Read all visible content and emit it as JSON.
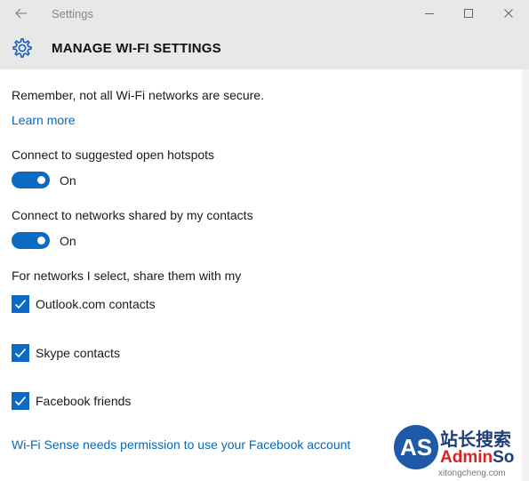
{
  "window": {
    "title": "Settings"
  },
  "header": {
    "title": "MANAGE WI-FI SETTINGS"
  },
  "main": {
    "intro": "Remember, not all Wi-Fi networks are secure.",
    "learn_more": "Learn more",
    "hotspots": {
      "label": "Connect to suggested open hotspots",
      "state": "On"
    },
    "contacts_networks": {
      "label": "Connect to networks shared by my contacts",
      "state": "On"
    },
    "share_heading": "For networks I select, share them with my",
    "share_options": [
      {
        "label": "Outlook.com contacts",
        "checked": true
      },
      {
        "label": "Skype contacts",
        "checked": true
      },
      {
        "label": "Facebook friends",
        "checked": true
      }
    ],
    "facebook_link": "Wi-Fi Sense needs permission to use your Facebook account"
  },
  "watermark": {
    "logo": "AS",
    "chinese": "站长搜索",
    "admin_part1": "Admin",
    "admin_part2": "So",
    "domain": "xitongcheng.com"
  },
  "colors": {
    "accent": "#0b6ac4",
    "link": "#0a67b6",
    "titlebar_bg": "#e8e8e8"
  }
}
